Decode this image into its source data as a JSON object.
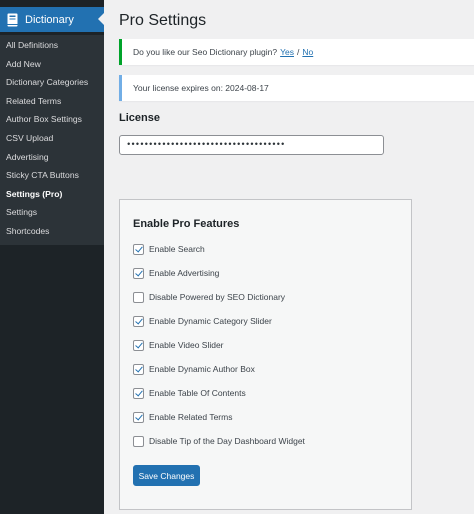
{
  "sidebar": {
    "menu_title": "Dictionary",
    "menu_icon": "book-icon",
    "items": [
      {
        "label": "All Definitions"
      },
      {
        "label": "Add New"
      },
      {
        "label": "Dictionary Categories"
      },
      {
        "label": "Related Terms"
      },
      {
        "label": "Author Box Settings"
      },
      {
        "label": "CSV Upload"
      },
      {
        "label": "Advertising"
      },
      {
        "label": "Sticky CTA Buttons"
      },
      {
        "label": "Settings (Pro)",
        "current": true
      },
      {
        "label": "Settings"
      },
      {
        "label": "Shortcodes"
      }
    ]
  },
  "page": {
    "title": "Pro Settings"
  },
  "notices": {
    "feedback": {
      "text": "Do you like our Seo Dictionary plugin?",
      "yes_label": "Yes",
      "separator": "/",
      "no_label": "No"
    },
    "license_expiry": "Your license expires on: 2024-08-17"
  },
  "license": {
    "label": "License",
    "value": "••••••••••••••••••••••••••••••••••••"
  },
  "pro_features": {
    "title": "Enable Pro Features",
    "options": [
      {
        "label": "Enable Search",
        "checked": true
      },
      {
        "label": "Enable Advertising",
        "checked": true
      },
      {
        "label": "Disable Powered by SEO Dictionary",
        "checked": false
      },
      {
        "label": "Enable Dynamic Category Slider",
        "checked": true
      },
      {
        "label": "Enable Video Slider",
        "checked": true
      },
      {
        "label": "Enable Dynamic Author Box",
        "checked": true
      },
      {
        "label": "Enable Table Of Contents",
        "checked": true
      },
      {
        "label": "Enable Related Terms",
        "checked": true
      },
      {
        "label": "Disable Tip of the Day Dashboard Widget",
        "checked": false
      }
    ],
    "save_label": "Save Changes"
  },
  "colors": {
    "sidebar_bg": "#1d2327",
    "submenu_bg": "#2c3338",
    "accent": "#2271b1",
    "success_border": "#00a32a",
    "info_border": "#72aee6"
  }
}
